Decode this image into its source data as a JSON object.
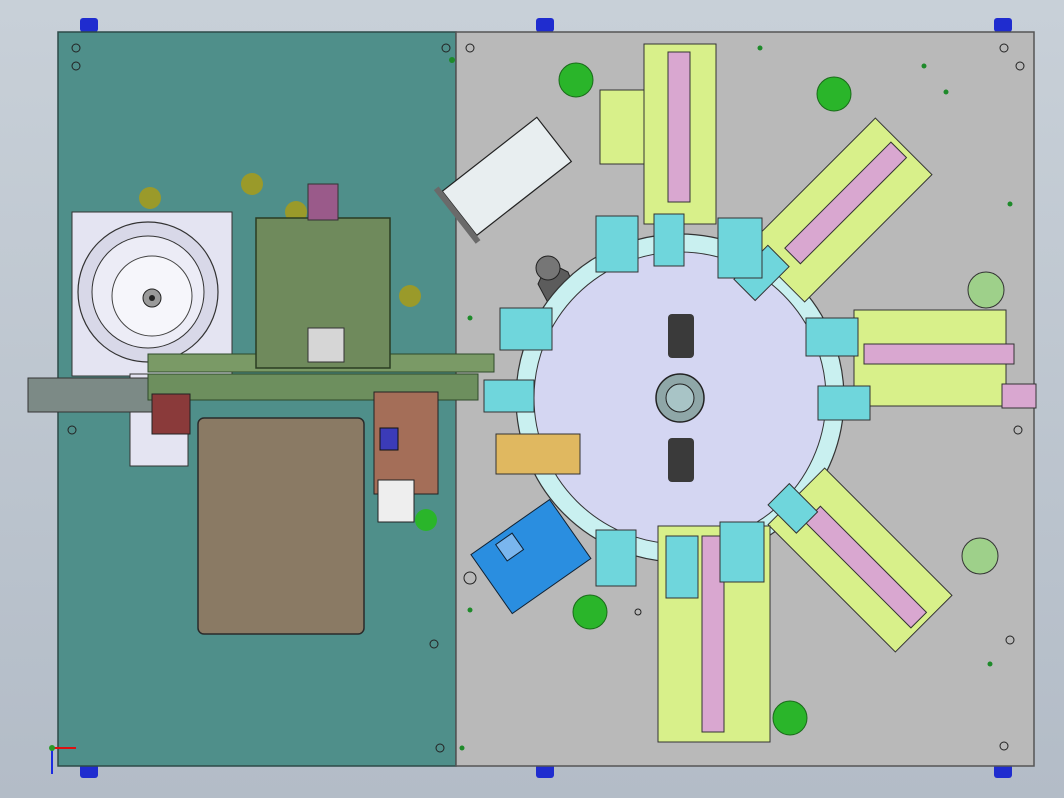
{
  "view": {
    "type": "cad-top-view",
    "background": "#bfc7d0",
    "left_plate_color": "#4f8f8a",
    "right_plate_color": "#b9b9b9",
    "frame_foot_color": "#1a27c8"
  },
  "assembly": {
    "rotary_table_color": "#cfd2ee",
    "ring_color": "#c9f0f0",
    "hub_color": "#8fa7a8",
    "bowl_feeder_color": "#e3e3f1",
    "station_count": 8,
    "station_palette": [
      "#d8f08a",
      "#f0e2a8",
      "#d9a7d0",
      "#6fd6dc",
      "#b9d37c"
    ],
    "accent_green": "#2ab52a",
    "cam_arm_color": "#5a5a5a",
    "sensor_blue": "#2a8ee0"
  },
  "triad": {
    "icons": [
      "axis-triad-icon"
    ]
  }
}
